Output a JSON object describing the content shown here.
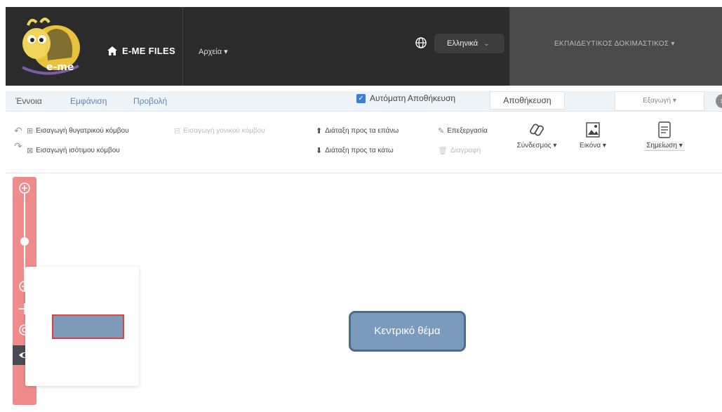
{
  "app": {
    "logo_text": "e-me",
    "brand": "E-ME FILES",
    "files_menu": "Αρχεία ▾",
    "language": "Ελληνικά",
    "user": "ΕΚΠΑΙΔΕΥΤΙΚΟΣ ΔΟΚΙΜΑΣΤΙΚΟΣ ▾"
  },
  "tabs": {
    "items": [
      "Έννοια",
      "Εμφάνιση",
      "Προβολή"
    ],
    "autosave_label": "Αυτόματη Αποθήκευση",
    "autosave_checked": true,
    "save_label": "Αποθήκευση",
    "export_label": "Εξαγωγή ▾"
  },
  "toolbar": {
    "insert_child": "Εισαγωγή θυγατρικού κόμβου",
    "insert_parent": "Εισαγωγή γονικού κόμβου",
    "insert_sibling": "Εισαγωγή ισότιμου κόμβου",
    "move_up": "Διάταξη προς τα επάνω",
    "move_down": "Διάταξη προς τα κάτω",
    "edit": "Επεξεργασία",
    "delete": "Διαγραφή",
    "link": "Σύνδεσμος ▾",
    "image": "Εικόνα ▾",
    "note": "Σημείωση ▾"
  },
  "canvas": {
    "central_topic": "Κεντρικό θέμα"
  }
}
